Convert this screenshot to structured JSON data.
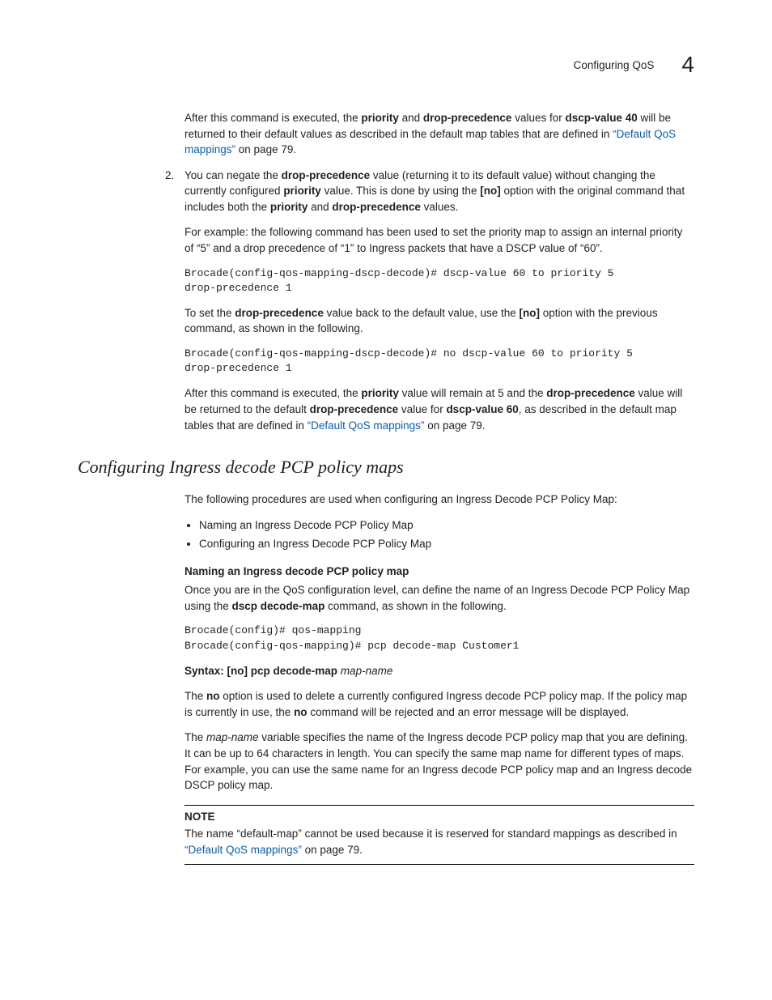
{
  "header": {
    "title": "Configuring QoS",
    "chapter": "4"
  },
  "p1": {
    "t1": "After this command is executed, the ",
    "b1": "priority",
    "t2": " and ",
    "b2": "drop-precedence",
    "t3": " values for ",
    "b3": "dscp-value 40",
    "t4": " will be returned to their default values as described in the default map tables that are defined in ",
    "link": "“Default QoS mappings”",
    "t5": " on page 79."
  },
  "li2": {
    "num": "2.",
    "p1": {
      "t1": "You can negate the ",
      "b1": "drop-precedence",
      "t2": " value (returning it to its default value) without changing the currently configured ",
      "b2": "priority",
      "t3": " value. This is done by using the ",
      "b3": "[no]",
      "t4": " option with the original command that includes both the ",
      "b4": "priority",
      "t5": " and ",
      "b5": "drop-precedence",
      "t6": " values."
    },
    "p2": "For example: the following command has been used to set the priority map to assign an internal priority of “5” and a drop precedence of “1” to Ingress packets that have a DSCP value of “60”.",
    "code1": "Brocade(config-qos-mapping-dscp-decode)# dscp-value 60 to priority 5 \ndrop-precedence 1",
    "p3": {
      "t1": "To set the ",
      "b1": "drop-precedence",
      "t2": " value back to the default value, use the ",
      "b2": "[no]",
      "t3": " option with the previous command, as shown in the following."
    },
    "code2": "Brocade(config-qos-mapping-dscp-decode)# no dscp-value 60 to priority 5 \ndrop-precedence 1",
    "p4": {
      "t1": "After this command is executed, the ",
      "b1": "priority",
      "t2": " value will remain at 5 and the ",
      "b2": "drop-precedence",
      "t3": " value will be returned to the default ",
      "b3": "drop-precedence",
      "t4": " value for ",
      "b4": "dscp-value 60",
      "t5": ", as described in the default map tables that are defined in ",
      "link": "“Default QoS mappings”",
      "t6": " on page 79."
    }
  },
  "sect": {
    "title": "Configuring Ingress decode PCP policy maps",
    "intro": "The following procedures are used when configuring an Ingress Decode PCP Policy Map:",
    "bullets": [
      "Naming an Ingress Decode PCP Policy Map",
      "Configuring an Ingress Decode PCP Policy Map"
    ]
  },
  "naming": {
    "title": "Naming an Ingress decode PCP policy map",
    "p1": {
      "t1": "Once you are in the QoS configuration level, can define the name of an Ingress Decode PCP Policy Map using the ",
      "b1": "dscp decode-map",
      "t2": " command, as shown in the following."
    },
    "code": "Brocade(config)# qos-mapping\nBrocade(config-qos-mapping)# pcp decode-map Customer1"
  },
  "syntax": {
    "b1": "Syntax:  ",
    "t1": "",
    "b2": "[no] pcp decode-map",
    "i1": "map-name"
  },
  "nopara": {
    "t1": "The ",
    "b1": "no",
    "t2": " option is used to delete a currently configured Ingress decode PCP policy map. If the policy map is currently in use, the ",
    "b2": "no",
    "t3": " command will be rejected and an error message will be displayed."
  },
  "mapname": {
    "t1": "The ",
    "i1": "map-name",
    "t2": " variable specifies the name of the Ingress decode PCP policy map that you are defining. It can be up to 64 characters in length. You can specify the same map name for different types of maps. For example, you can use the same name for an Ingress decode PCP policy map and an Ingress decode DSCP policy map."
  },
  "note": {
    "h": "NOTE",
    "t1": "The name “default-map” cannot be used because it is reserved for standard mappings as described in ",
    "link": "“Default QoS mappings”",
    "t2": " on page 79."
  }
}
